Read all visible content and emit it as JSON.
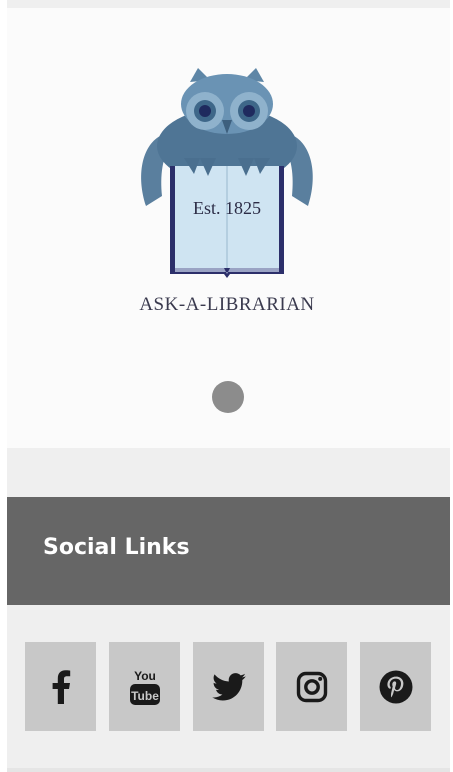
{
  "logo": {
    "est_label": "Est. 1825",
    "brand_label": "ASK-A-LIBRARIAN"
  },
  "slider": {
    "dot_color": "#8c8c8c"
  },
  "social": {
    "title": "Social Links",
    "header_color": "#666666",
    "button_color": "#c8c8c8",
    "links": [
      {
        "icon": "facebook-icon"
      },
      {
        "icon": "youtube-icon",
        "icon_text_top": "You",
        "icon_text_bottom": "Tube"
      },
      {
        "icon": "twitter-icon"
      },
      {
        "icon": "instagram-icon"
      },
      {
        "icon": "pinterest-icon"
      }
    ]
  }
}
